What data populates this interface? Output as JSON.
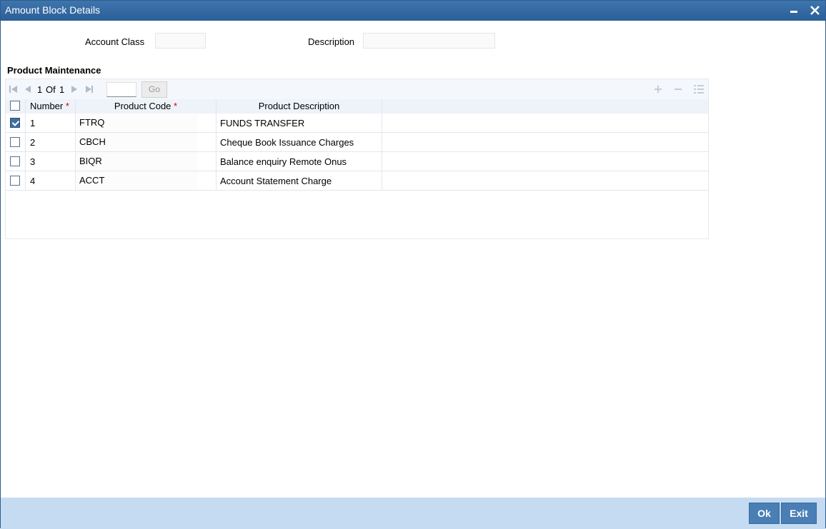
{
  "window": {
    "title": "Amount Block Details"
  },
  "form": {
    "account_class_label": "Account Class",
    "account_class_value": "",
    "description_label": "Description",
    "description_value": ""
  },
  "section": {
    "title": "Product Maintenance"
  },
  "pager": {
    "current": "1",
    "of_label": "Of",
    "total": "1",
    "go_label": "Go",
    "page_value": ""
  },
  "table": {
    "columns": [
      {
        "label": "Number",
        "required": "*"
      },
      {
        "label": "Product Code",
        "required": "*"
      },
      {
        "label": "Product Description"
      }
    ],
    "rows": [
      {
        "number": "1",
        "code": "FTRQ",
        "description": "FUNDS TRANSFER",
        "checked": true
      },
      {
        "number": "2",
        "code": "CBCH",
        "description": "Cheque Book Issuance Charges",
        "checked": false
      },
      {
        "number": "3",
        "code": "BIQR",
        "description": "Balance enquiry Remote Onus",
        "checked": false
      },
      {
        "number": "4",
        "code": "ACCT",
        "description": "Account Statement Charge",
        "checked": false
      }
    ]
  },
  "footer": {
    "ok_label": "Ok",
    "exit_label": "Exit"
  },
  "colors": {
    "titlebar": "#2a5e98",
    "footer": "#c5dbf1",
    "button": "#4a7fb5",
    "required": "#cc0000"
  }
}
